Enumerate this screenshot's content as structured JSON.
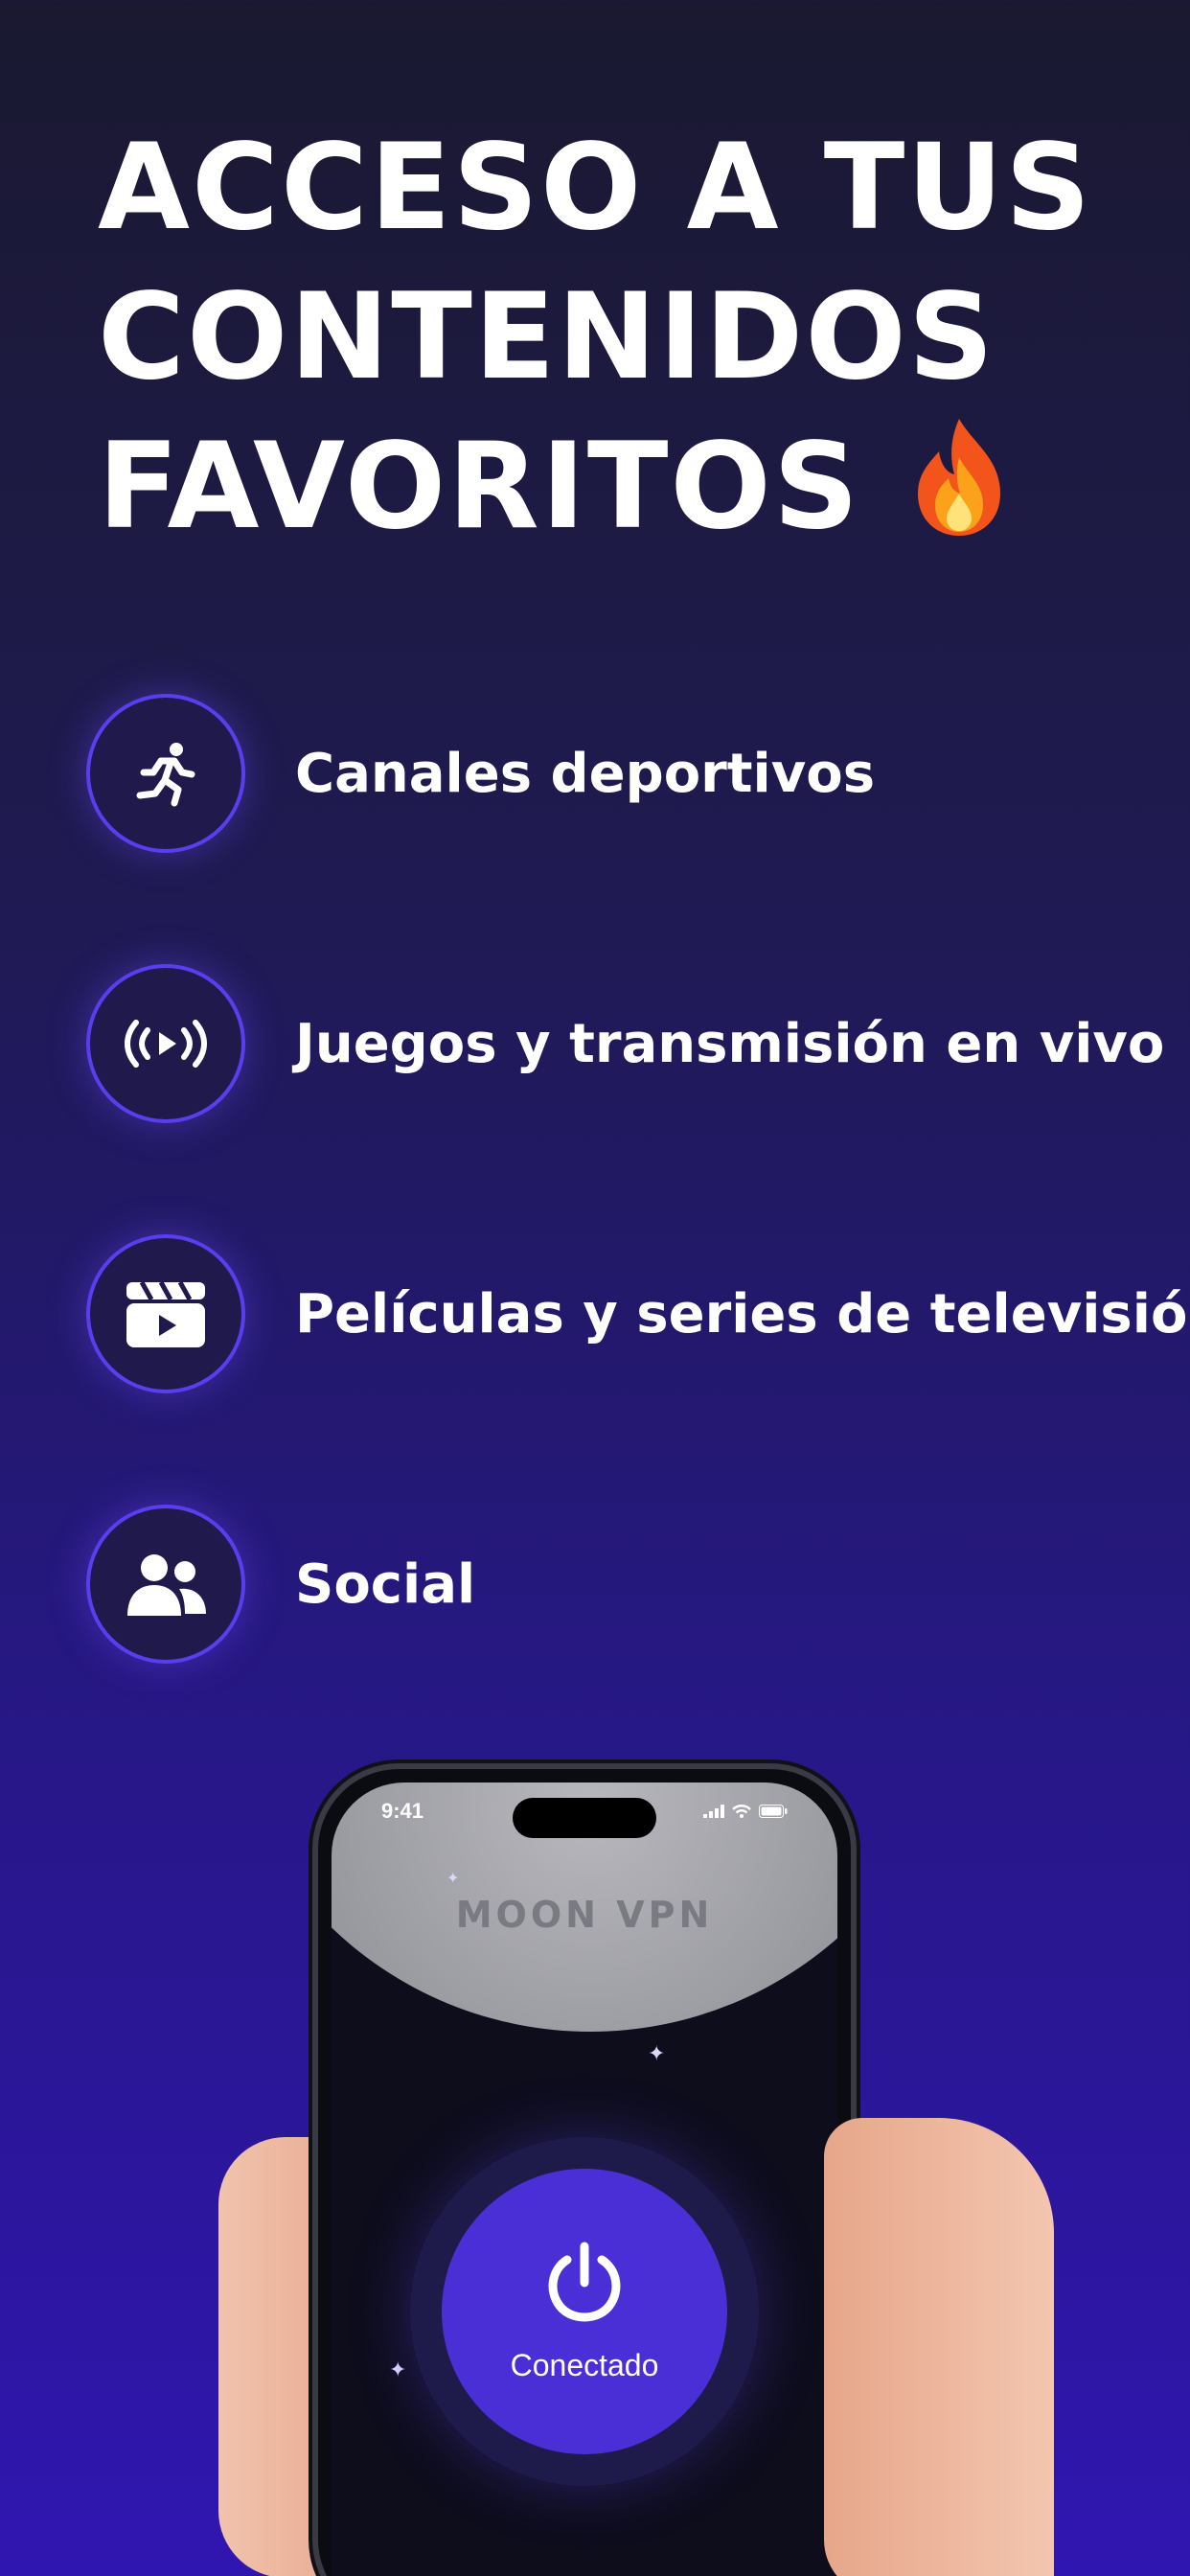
{
  "headline": {
    "lines": [
      "ACCESO A TUS",
      "CONTENIDOS",
      "FAVORITOS"
    ],
    "emoji_icon": "fire-icon"
  },
  "features": [
    {
      "icon": "running-person-icon",
      "label": "Canales deportivos"
    },
    {
      "icon": "live-broadcast-icon",
      "label": "Juegos y transmisión en vivo"
    },
    {
      "icon": "clapperboard-icon",
      "label": "Películas y series de televisión"
    },
    {
      "icon": "people-icon",
      "label": "Social"
    }
  ],
  "phone": {
    "status_time": "9:41",
    "brand": "MOON VPN",
    "power_label": "Conectado"
  },
  "colors": {
    "accent": "#4a2fd6",
    "ring": "#5b3df0",
    "bg_top": "#1a1930",
    "bg_bottom": "#3016b0"
  }
}
